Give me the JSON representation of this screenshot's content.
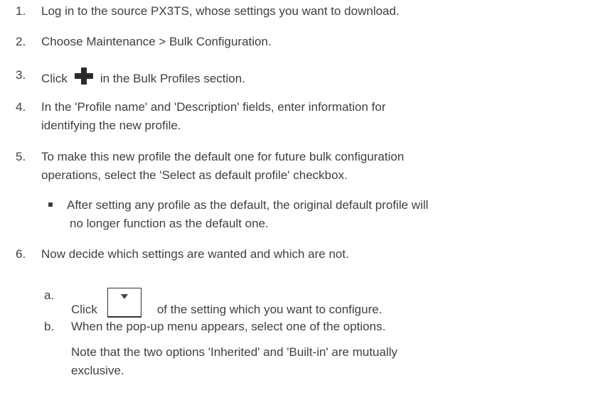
{
  "steps": [
    {
      "num": "1.",
      "text": "Log in to the source PX3TS, whose settings you want to download."
    },
    {
      "num": "2.",
      "text": "Choose Maintenance > Bulk Configuration."
    },
    {
      "num": "3.",
      "text_before": "Click",
      "text_after": "in the Bulk Profiles section."
    },
    {
      "num": "4.",
      "text_line1": "In the 'Profile name' and 'Description' fields, enter information for",
      "text_line2": "identifying the new profile."
    },
    {
      "num": "5.",
      "text_line1": "To make this new profile the default one for future bulk configuration",
      "text_line2": "operations, select the 'Select as default profile' checkbox."
    },
    {
      "num": "6.",
      "text": "Now decide which settings are wanted and which are not."
    }
  ],
  "bullet": {
    "line1": "After setting any profile as the default, the original default profile will",
    "line2": "no longer function as the default one."
  },
  "substeps": [
    {
      "letter": "a.",
      "text_before": "Click",
      "text_after": "of the setting which you want to configure."
    },
    {
      "letter": "b.",
      "text": "When the pop-up menu appears, select one of the options."
    }
  ],
  "note": {
    "line1": "Note that the two options 'Inherited' and 'Built-in' are mutually",
    "line2": "exclusive."
  },
  "icons": {
    "add": "plus-icon",
    "dropdown": "dropdown-arrow-icon"
  }
}
